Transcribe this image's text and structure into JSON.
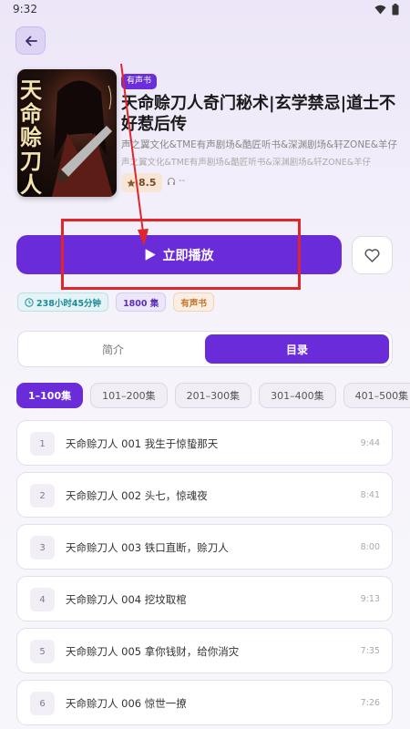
{
  "status_bar": {
    "time": "9:32"
  },
  "book": {
    "tag": "有声书",
    "title": "天命赊刀人奇门秘术|玄学禁忌|道士不好惹后传",
    "authors_line1": "声之翼文化&TME有声剧场&酷匠听书&深渊剧场&轩ZONE&羊仔",
    "authors_line2": "声之翼文化&TME有声剧场&酷匠听书&深渊剧场&轩ZONE&羊仔",
    "rating": "8.5",
    "listen_count": "--",
    "cover_text": "天命赊刀人"
  },
  "actions": {
    "play_label": "立即播放"
  },
  "badges": {
    "duration": "238小时45分钟",
    "episodes": "1800 集",
    "type": "有声书"
  },
  "tabs": [
    {
      "label": "简介"
    },
    {
      "label": "目录"
    }
  ],
  "ranges": [
    "1–100集",
    "101–200集",
    "201–300集",
    "301–400集",
    "401–500集"
  ],
  "episodes": [
    {
      "num": "1",
      "title": "天命赊刀人 001 我生于惊蛰那天",
      "duration": "9:44"
    },
    {
      "num": "2",
      "title": "天命赊刀人 002 头七，惊魂夜",
      "duration": "8:41"
    },
    {
      "num": "3",
      "title": "天命赊刀人 003 铁口直断，赊刀人",
      "duration": "8:00"
    },
    {
      "num": "4",
      "title": "天命赊刀人 004 挖坟取棺",
      "duration": "9:13"
    },
    {
      "num": "5",
      "title": "天命赊刀人 005 拿你钱财，给你消灾",
      "duration": "7:35"
    },
    {
      "num": "6",
      "title": "天命赊刀人 006 惊世一撩",
      "duration": "7:26"
    }
  ],
  "colors": {
    "accent": "#6a2bd9",
    "annotation": "#e0262b"
  }
}
